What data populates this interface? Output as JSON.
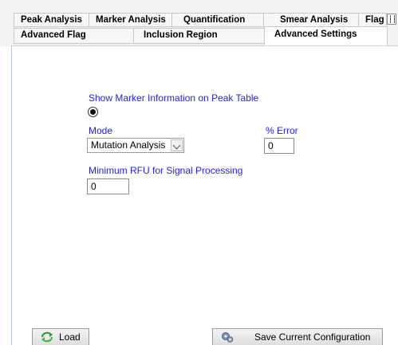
{
  "tabs": {
    "row1": [
      "Peak Analysis",
      "Marker Analysis",
      "Quantification",
      "Smear Analysis",
      "Flag"
    ],
    "row2": [
      "Advanced Flag",
      "Inclusion Region",
      "Advanced Settings"
    ],
    "active": "Advanced Settings"
  },
  "settings": {
    "show_marker_label": "Show Marker Information on Peak Table",
    "show_marker_selected": true,
    "mode_label": "Mode",
    "mode_value": "Mutation Analysis",
    "error_label": "% Error",
    "error_value": "0",
    "min_rfu_label": "Minimum RFU for Signal Processing",
    "min_rfu_value": "0"
  },
  "buttons": {
    "load": "Load",
    "save": "Save Current Configuration"
  },
  "icons": {
    "load": "recycle-arrows-icon",
    "save": "gears-icon",
    "tab_scroll": "tab-scroll-icon"
  }
}
